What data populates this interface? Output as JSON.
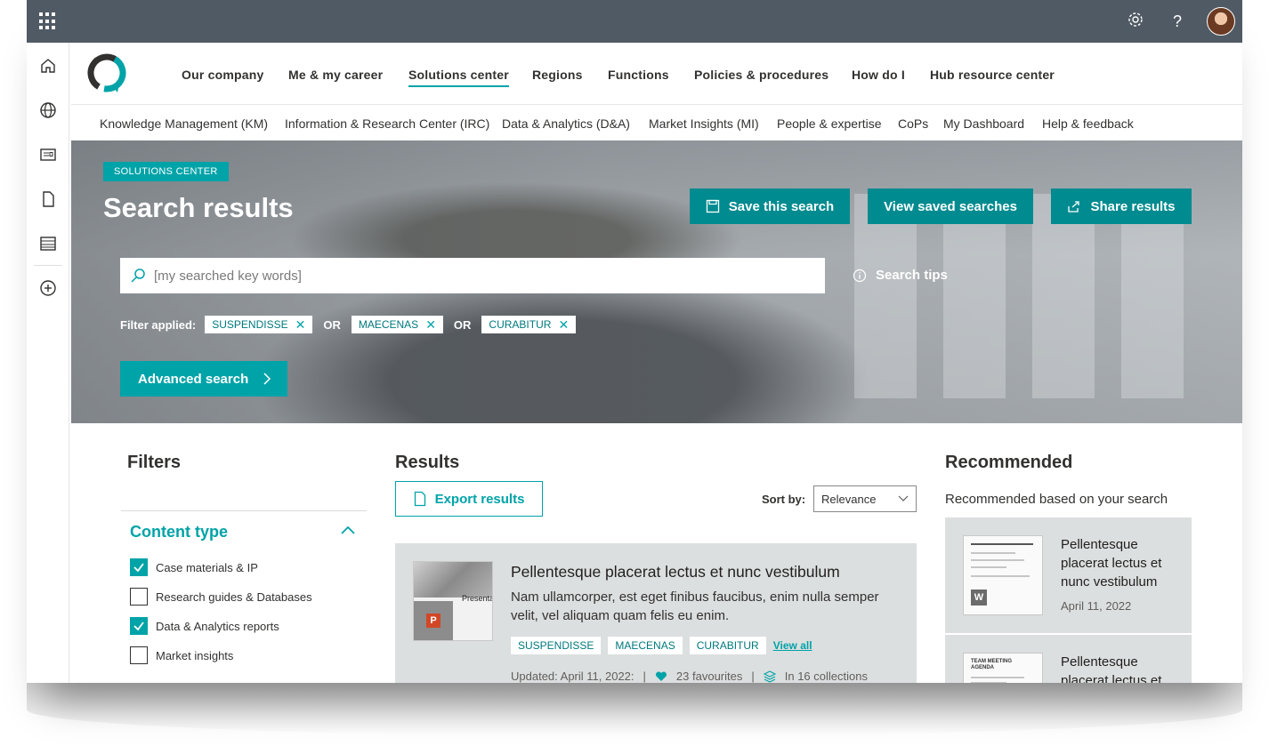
{
  "suite": {
    "settings_icon": "gear-icon",
    "help_label": "?",
    "avatar_icon": "user-avatar"
  },
  "rail": {
    "icons": [
      "home-icon",
      "globe-icon",
      "news-icon",
      "document-icon",
      "list-icon",
      "add-icon"
    ]
  },
  "hubnav": {
    "items": [
      "Our company",
      "Me & my career",
      "Solutions center",
      "Regions",
      "Functions",
      "Policies & procedures",
      "How do I",
      "Hub resource center"
    ],
    "active": "Solutions center"
  },
  "subnav": {
    "items": [
      "Knowledge Management (KM)",
      "Information & Research Center (IRC)",
      "Data & Analytics (D&A)",
      "Market Insights (MI)",
      "People & expertise",
      "CoPs",
      "My Dashboard",
      "Help & feedback"
    ]
  },
  "hero": {
    "badge": "SOLUTIONS CENTER",
    "title": "Search results",
    "save_label": "Save this search",
    "view_saved_label": "View saved searches",
    "share_label": "Share results",
    "search_placeholder": "[my searched key words]",
    "search_tips_label": "Search tips",
    "filter_label": "Filter applied:",
    "or_label": "OR",
    "chips": [
      "SUSPENDISSE",
      "MAECENAS",
      "CURABITUR"
    ],
    "advanced_label": "Advanced search"
  },
  "filters": {
    "heading": "Filters",
    "group_title": "Content type",
    "options": [
      {
        "label": "Case materials & IP",
        "checked": true
      },
      {
        "label": "Research guides & Databases",
        "checked": false
      },
      {
        "label": "Data & Analytics reports",
        "checked": true
      },
      {
        "label": "Market insights",
        "checked": false
      }
    ]
  },
  "results": {
    "heading": "Results",
    "export_label": "Export results",
    "sort_label": "Sort by:",
    "sort_value": "Relevance",
    "items": [
      {
        "thumb_label": "Presenta",
        "thumb_badge": "P",
        "title": "Pellentesque placerat lectus et nunc vestibulum",
        "description": "Nam ullamcorper, est eget finibus faucibus, enim nulla semper velit, vel aliquam quam felis eu enim.",
        "tags": [
          "SUSPENDISSE",
          "MAECENAS",
          "CURABITUR"
        ],
        "view_all": "View all",
        "updated": "Updated: April 11, 2022:",
        "favourites": "23 favourites",
        "collections": "In 16 collections"
      }
    ]
  },
  "recommended": {
    "heading": "Recommended",
    "subheading": "Recommended based on your search",
    "items": [
      {
        "title": "Pellentesque placerat lectus et nunc vestibulum",
        "date": "April 11, 2022",
        "thumb_badge": "W"
      },
      {
        "title": "Pellentesque placerat lectus et",
        "thumb_heading": "TEAM MEETING AGENDA"
      }
    ]
  },
  "colors": {
    "accent": "#00a3a8",
    "accent_dark": "#008b90",
    "suitebar": "#505a64",
    "card_bg": "#dcdfdf"
  }
}
